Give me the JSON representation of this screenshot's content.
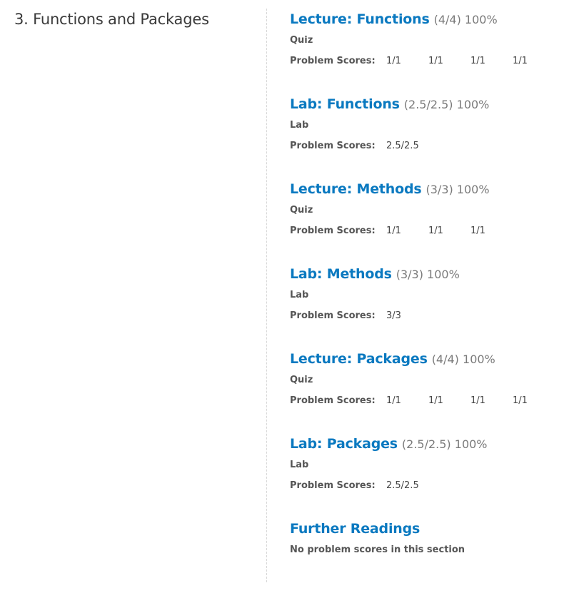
{
  "chapter": {
    "title": "3. Functions and Packages"
  },
  "labels": {
    "problem_scores": "Problem Scores:",
    "no_scores": "No problem scores in this section"
  },
  "sections": [
    {
      "name": "Lecture: Functions",
      "score": "(4/4) 100%",
      "type": "Quiz",
      "problem_scores": [
        "1/1",
        "1/1",
        "1/1",
        "1/1"
      ]
    },
    {
      "name": "Lab: Functions",
      "score": "(2.5/2.5) 100%",
      "type": "Lab",
      "problem_scores": [
        "2.5/2.5"
      ]
    },
    {
      "name": "Lecture: Methods",
      "score": "(3/3) 100%",
      "type": "Quiz",
      "problem_scores": [
        "1/1",
        "1/1",
        "1/1"
      ]
    },
    {
      "name": "Lab: Methods",
      "score": "(3/3) 100%",
      "type": "Lab",
      "problem_scores": [
        "3/3"
      ]
    },
    {
      "name": "Lecture: Packages",
      "score": "(4/4) 100%",
      "type": "Quiz",
      "problem_scores": [
        "1/1",
        "1/1",
        "1/1",
        "1/1"
      ]
    },
    {
      "name": "Lab: Packages",
      "score": "(2.5/2.5) 100%",
      "type": "Lab",
      "problem_scores": [
        "2.5/2.5"
      ]
    }
  ],
  "further_readings": {
    "name": "Further Readings"
  },
  "colors": {
    "link": "#0a79c0",
    "muted": "#7a7a7a",
    "label": "#555555",
    "divider": "#d7d7d7"
  }
}
